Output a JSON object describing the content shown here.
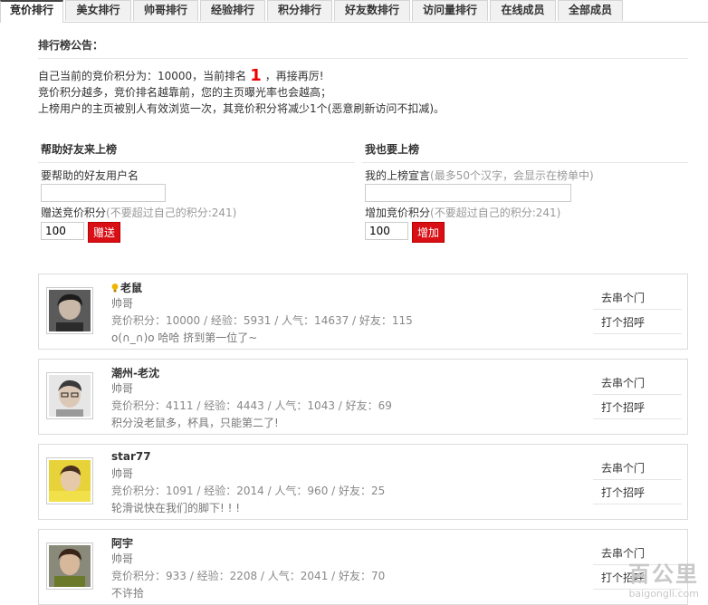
{
  "tabs": [
    {
      "label": "竞价排行",
      "active": true
    },
    {
      "label": "美女排行"
    },
    {
      "label": "帅哥排行"
    },
    {
      "label": "经验排行"
    },
    {
      "label": "积分排行"
    },
    {
      "label": "好友数排行"
    },
    {
      "label": "访问量排行"
    },
    {
      "label": "在线成员"
    },
    {
      "label": "全部成员"
    }
  ],
  "notice": {
    "title": "排行榜公告：",
    "line1_pre": "自己当前的竞价积分为：10000，当前排名",
    "rank": "1",
    "line1_post": "，再接再厉!",
    "line2": "竞价积分越多，竞价排名越靠前，您的主页曝光率也会越高；",
    "line3": "上榜用户的主页被别人有效浏览一次，其竞价积分将减少1个(恶意刷新访问不扣减)。"
  },
  "help_friend": {
    "title": "帮助好友来上榜",
    "name_label": "要帮助的好友用户名",
    "name_value": "",
    "points_label": "赠送竞价积分",
    "points_hint": "(不要超过自己的积分:241)",
    "points_value": "100",
    "button": "赠送"
  },
  "self_rank": {
    "title": "我也要上榜",
    "slogan_label": "我的上榜宣言",
    "slogan_hint": "(最多50个汉字，会显示在榜单中)",
    "slogan_value": "",
    "points_label": "增加竞价积分",
    "points_hint": "(不要超过自己的积分:241)",
    "points_value": "100",
    "button": "增加"
  },
  "users": [
    {
      "name": "老鼠",
      "title": "帅哥",
      "stats": "竞价积分：10000 / 经验：5931 / 人气：14637 / 好友：115",
      "message": "o(∩_∩)o 哈哈 挤到第一位了~",
      "visit": "去串个门",
      "greet": "打个招呼",
      "bulb": true
    },
    {
      "name": "潮州-老沈",
      "title": "帅哥",
      "stats": "竞价积分：4111 / 经验：4443 / 人气：1043 / 好友：69",
      "message": "积分没老鼠多，杯具，只能第二了!",
      "visit": "去串个门",
      "greet": "打个招呼"
    },
    {
      "name": "star77",
      "title": "帅哥",
      "stats": "竞价积分：1091 / 经验：2014 / 人气：960 / 好友：25",
      "message": "轮滑说快在我们的脚下! ! !",
      "visit": "去串个门",
      "greet": "打个招呼"
    },
    {
      "name": "阿宇",
      "title": "帅哥",
      "stats": "竞价积分：933 / 经验：2208 / 人气：2041 / 好友：70",
      "message": "不许拾",
      "visit": "去串个门",
      "greet": "打个招呼"
    }
  ],
  "watermark": {
    "line1": "百公里",
    "line2": "baigongli.com"
  },
  "colors": {
    "accent": "#d80f15",
    "rank": "#e00000",
    "border": "#dcdcdc"
  }
}
